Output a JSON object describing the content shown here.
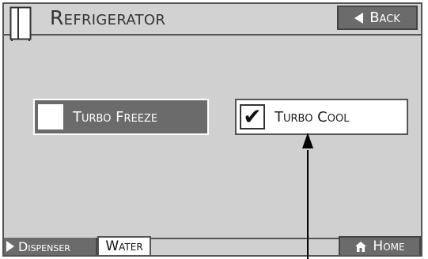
{
  "header": {
    "title": "Refrigerator",
    "back_label": "Back"
  },
  "main": {
    "turbo_freeze": {
      "label": "Turbo Freeze",
      "checked": false
    },
    "turbo_cool": {
      "label": "Turbo Cool",
      "checked": true,
      "check_glyph": "✔"
    }
  },
  "footer": {
    "dispenser_label": "Dispenser",
    "water_label": "Water",
    "home_label": "Home"
  },
  "icons": {
    "fridge": "fridge-icon",
    "back": "triangle-left-icon",
    "dispenser": "triangle-right-icon",
    "home": "house-icon"
  },
  "colors": {
    "panel_bg": "#d0d0d0",
    "button_dark": "#6b6b6b",
    "border": "#555555"
  }
}
